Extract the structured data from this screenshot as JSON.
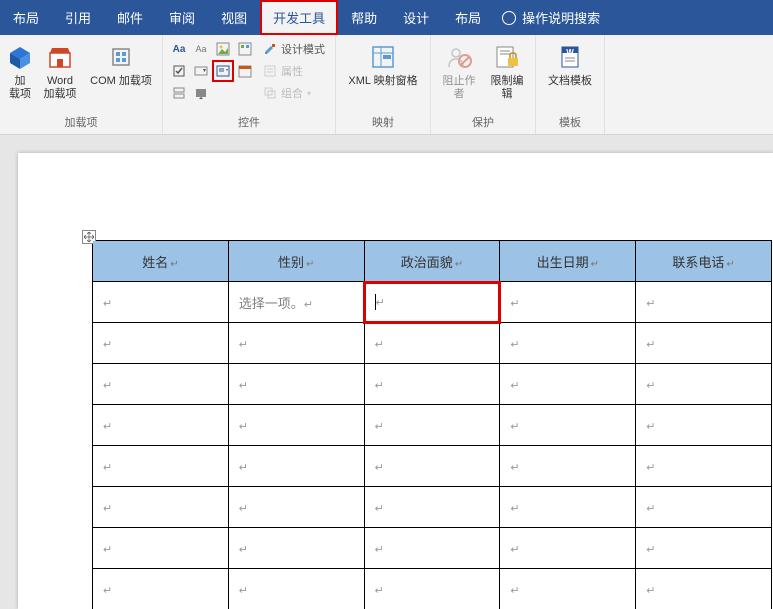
{
  "tabs": {
    "layout1": "布局",
    "reference": "引用",
    "mailings": "邮件",
    "review": "审阅",
    "view": "视图",
    "developer": "开发工具",
    "help": "帮助",
    "design": "设计",
    "layout2": "布局",
    "tell_me": "操作说明搜索"
  },
  "groups": {
    "addins": {
      "label": "加载项",
      "btn_addins": "加\n载项",
      "btn_word": "Word\n加载项",
      "btn_com": "COM 加载项"
    },
    "controls": {
      "label": "控件",
      "design_mode": "设计模式",
      "properties": "属性",
      "group_ctrl": "组合"
    },
    "mapping": {
      "label": "映射",
      "btn": "XML 映射窗格"
    },
    "protect": {
      "label": "保护",
      "block": "阻止作者",
      "restrict": "限制编辑"
    },
    "template": {
      "label": "模板",
      "btn": "文档模板"
    }
  },
  "table": {
    "headers": [
      "姓名",
      "性别",
      "政治面貌",
      "出生日期",
      "联系电话"
    ],
    "placeholder": "选择一项。",
    "cell_mark": "↵"
  }
}
